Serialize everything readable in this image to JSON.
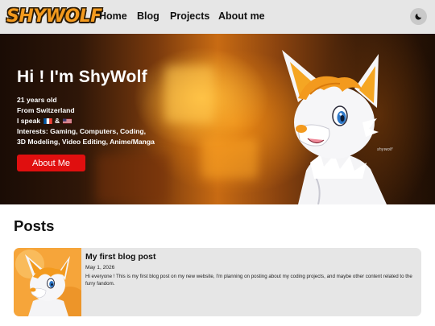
{
  "nav": {
    "logo_text": "SHYWOLF",
    "links": [
      "Home",
      "Blog",
      "Projects",
      "About me"
    ],
    "theme_icon": "moon-icon"
  },
  "hero": {
    "title": "Hi ! I'm ShyWolf",
    "age": "21 years old",
    "origin": "From Switzerland",
    "languages_prefix": "I speak",
    "languages_sep": "&",
    "languages_flags": [
      "fr-flag-icon",
      "us-flag-icon"
    ],
    "interests_line1": "Interests: Gaming, Computers, Coding,",
    "interests_line2": "3D Modeling, Video Editing, Anime/Manga",
    "button_label": "About Me",
    "button_color": "#e00f0f"
  },
  "posts": {
    "heading": "Posts",
    "items": [
      {
        "title": "My first blog post",
        "date": "May 1, 2026",
        "excerpt": "Hi everyone ! This is my first blog post on my new website, I'm planning on posting about my coding projects, and maybe other content related to the furry fandom."
      }
    ]
  },
  "colors": {
    "nav_bg": "#e6e6e6",
    "logo_orange": "#f39a1e",
    "card_bg": "#e6e6e6"
  }
}
